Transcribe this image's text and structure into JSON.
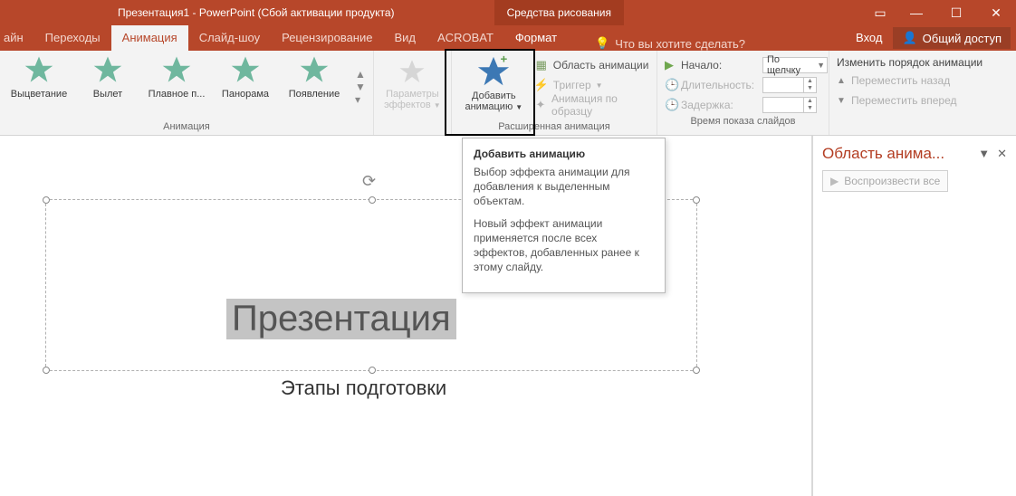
{
  "titlebar": {
    "title": "Презентация1 - PowerPoint (Сбой активации продукта)",
    "ctx_tool": "Средства рисования"
  },
  "tabs": {
    "left_clip": "айн",
    "items": [
      "Переходы",
      "Анимация",
      "Слайд-шоу",
      "Рецензирование",
      "Вид",
      "ACROBAT",
      "Формат"
    ],
    "active_index": 1,
    "tell_me": "Что вы хотите сделать?",
    "login": "Вход",
    "share": "Общий доступ"
  },
  "ribbon": {
    "anim_gallery": {
      "items": [
        {
          "label": "Выцветание"
        },
        {
          "label": "Вылет"
        },
        {
          "label": "Плавное п..."
        },
        {
          "label": "Панорама"
        },
        {
          "label": "Появление"
        }
      ],
      "group_label": "Анимация"
    },
    "params": {
      "l1": "Параметры",
      "l2": "эффектов"
    },
    "add_anim": {
      "l1": "Добавить",
      "l2": "анимацию"
    },
    "advanced": {
      "rows": {
        "pane": "Область анимации",
        "trigger": "Триггер",
        "painter": "Анимация по образцу"
      },
      "group_label": "Расширенная анимация"
    },
    "timing": {
      "start": "Начало:",
      "start_val": "По щелчку",
      "duration": "Длительность:",
      "delay": "Задержка:",
      "group_label": "Время показа слайдов"
    },
    "reorder": {
      "title": "Изменить порядок анимации",
      "back": "Переместить назад",
      "fwd": "Переместить вперед"
    }
  },
  "tooltip": {
    "title": "Добавить анимацию",
    "p1": "Выбор эффекта анимации для добавления к выделенным объектам.",
    "p2": "Новый эффект анимации применяется после всех эффектов, добавленных ранее к этому слайду."
  },
  "slide": {
    "title": "Презентация",
    "subtitle": "Этапы подготовки"
  },
  "pane": {
    "title": "Область анима...",
    "play": "Воспроизвести все"
  }
}
